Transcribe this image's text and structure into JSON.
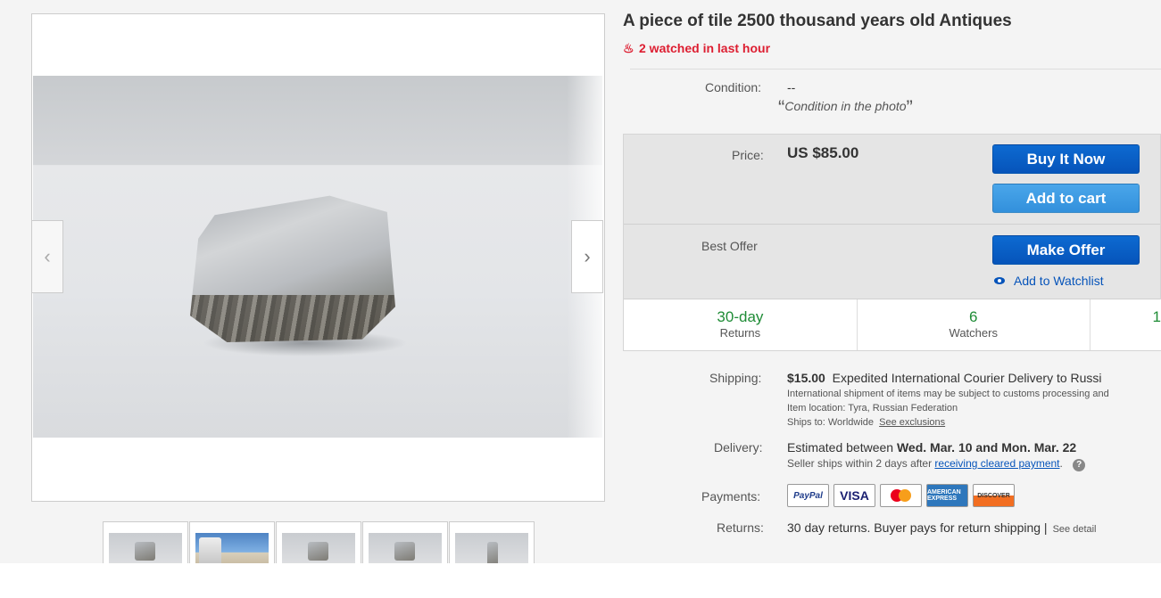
{
  "listing": {
    "title": "A piece of tile 2500 thousand years old Antiques",
    "watch_alert": "2 watched in last hour",
    "condition_label": "Condition:",
    "condition_value": "--",
    "condition_note": "Condition in the photo"
  },
  "gallery": {
    "prev_icon": "chevron-left-icon",
    "next_icon": "chevron-right-icon",
    "thumbnails": [
      "thumb-1",
      "thumb-2",
      "thumb-3",
      "thumb-4",
      "thumb-5"
    ]
  },
  "buy_box": {
    "price_label": "Price:",
    "price_value": "US $85.00",
    "buy_now_label": "Buy It Now",
    "add_to_cart_label": "Add to cart",
    "best_offer_label": "Best Offer",
    "make_offer_label": "Make Offer",
    "watchlist_label": "Add to Watchlist",
    "stats": [
      {
        "big": "30-day",
        "small": "Returns"
      },
      {
        "big": "6",
        "small": "Watchers"
      },
      {
        "big": "1",
        "small": ""
      }
    ]
  },
  "shipping": {
    "label": "Shipping:",
    "cost": "$15.00",
    "service": "Expedited International Courier Delivery to Russi",
    "note_1": "International shipment of items may be subject to customs processing and",
    "location": "Item location:  Tyra, Russian Federation",
    "ships_to": "Ships to:  Worldwide",
    "exclusions_link": "See exclusions"
  },
  "delivery": {
    "label": "Delivery:",
    "prefix": "Estimated between ",
    "dates": "Wed. Mar. 10 and Mon. Mar. 22",
    "note_prefix": "Seller ships within 2 days after ",
    "note_link": "receiving cleared payment",
    "help": "?"
  },
  "payments": {
    "label": "Payments:",
    "methods": [
      "PayPal",
      "VISA",
      "",
      "AMERICAN EXPRESS",
      "DISCOVER"
    ]
  },
  "returns": {
    "label": "Returns:",
    "value": "30 day returns. Buyer pays for return shipping |",
    "see_details": "See detail"
  },
  "colors": {
    "alert_red": "#dd1e31",
    "primary_blue": "#0654ba",
    "secondary_blue": "#3290dc",
    "stat_green": "#1f8c36"
  }
}
